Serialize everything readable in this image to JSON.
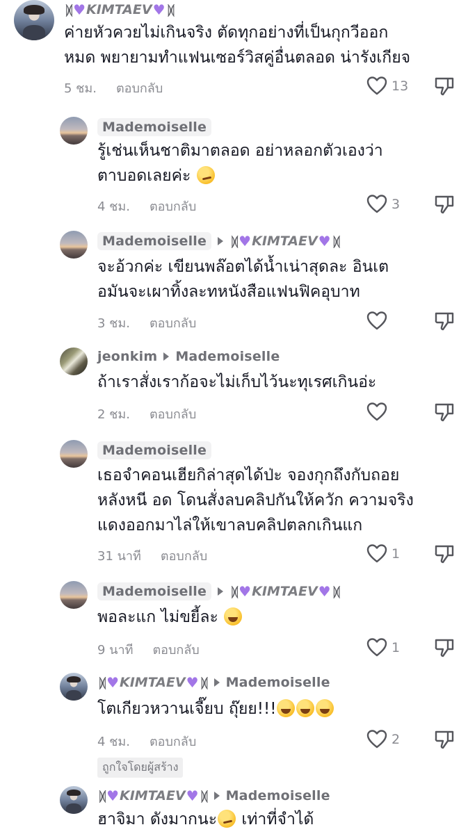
{
  "comments": [
    {
      "author": "KIMTAEV",
      "lines": [
        "ค่ายหัวควยไม่เกินจริง ตัดทุกอย่างที่เป็นกุกวีออก",
        "หมด พยายามทำแฟนเซอร์วิสคู่อื่นตลอด น่ารังเกียจ"
      ],
      "time": "5 ชม.",
      "reply": "ตอบกลับ",
      "likes": "13"
    },
    {
      "author": "Mademoiselle",
      "lines": [
        "รู้เช่นเห็นชาติมาตลอด อย่าหลอกตัวเองว่า",
        "ตาบอดเลยค่ะ"
      ],
      "time": "4 ชม.",
      "reply": "ตอบกลับ",
      "likes": "3"
    },
    {
      "author": "Mademoiselle",
      "reply_to": "KIMTAEV",
      "lines": [
        "จะอ้วกค่ะ เขียนพล๊อตได้น้ำเน่าสุดละ อินเต",
        "อมันจะเผาทิ้งละทหนังสือแฟนฟิคอุบาท"
      ],
      "time": "3 ชม.",
      "reply": "ตอบกลับ",
      "likes": ""
    },
    {
      "author": "jeonkim",
      "reply_to": "Mademoiselle",
      "lines": [
        "ถ้าเราสั่งเราก้อจะไม่เก็บไว้นะทุเรศเกินอ่ะ"
      ],
      "time": "2 ชม.",
      "reply": "ตอบกลับ",
      "likes": ""
    },
    {
      "author": "Mademoiselle",
      "lines": [
        "เธอจำคอนเฮียกิล่าสุดได้ป่ะ จองกุกถึงกับถอย",
        "หลังหนี อด โดนสั่งลบคลิปกันให้ควัก ความจริง",
        "แดงออกมาไล่ให้เขาลบคลิปตลกเกินแก"
      ],
      "time": "31 นาที",
      "reply": "ตอบกลับ",
      "likes": "1"
    },
    {
      "author": "Mademoiselle",
      "reply_to": "KIMTAEV",
      "lines": [
        "พอละแก ไม่ขยี้ละ"
      ],
      "time": "9 นาที",
      "reply": "ตอบกลับ",
      "likes": "1"
    },
    {
      "author": "KIMTAEV",
      "reply_to": "Mademoiselle",
      "lines": [
        "โตเกียวหวานเจี๊ยบ ถุ๊ยย!!!"
      ],
      "time": "4 ชม.",
      "reply": "ตอบกลับ",
      "likes": "2",
      "badge": "ถูกใจโดยผู้สร้าง"
    },
    {
      "author": "KIMTAEV",
      "reply_to": "Mademoiselle",
      "lines": [
        "ฮาจิมา ดังมากนะ",
        "เท่าที่จำได้"
      ]
    }
  ],
  "icons": {
    "heart": "heart-outline-icon",
    "dislike": "thumbs-down-icon",
    "reply_arrow": "caret-right-icon",
    "name_heart_color": "#a276e7"
  }
}
